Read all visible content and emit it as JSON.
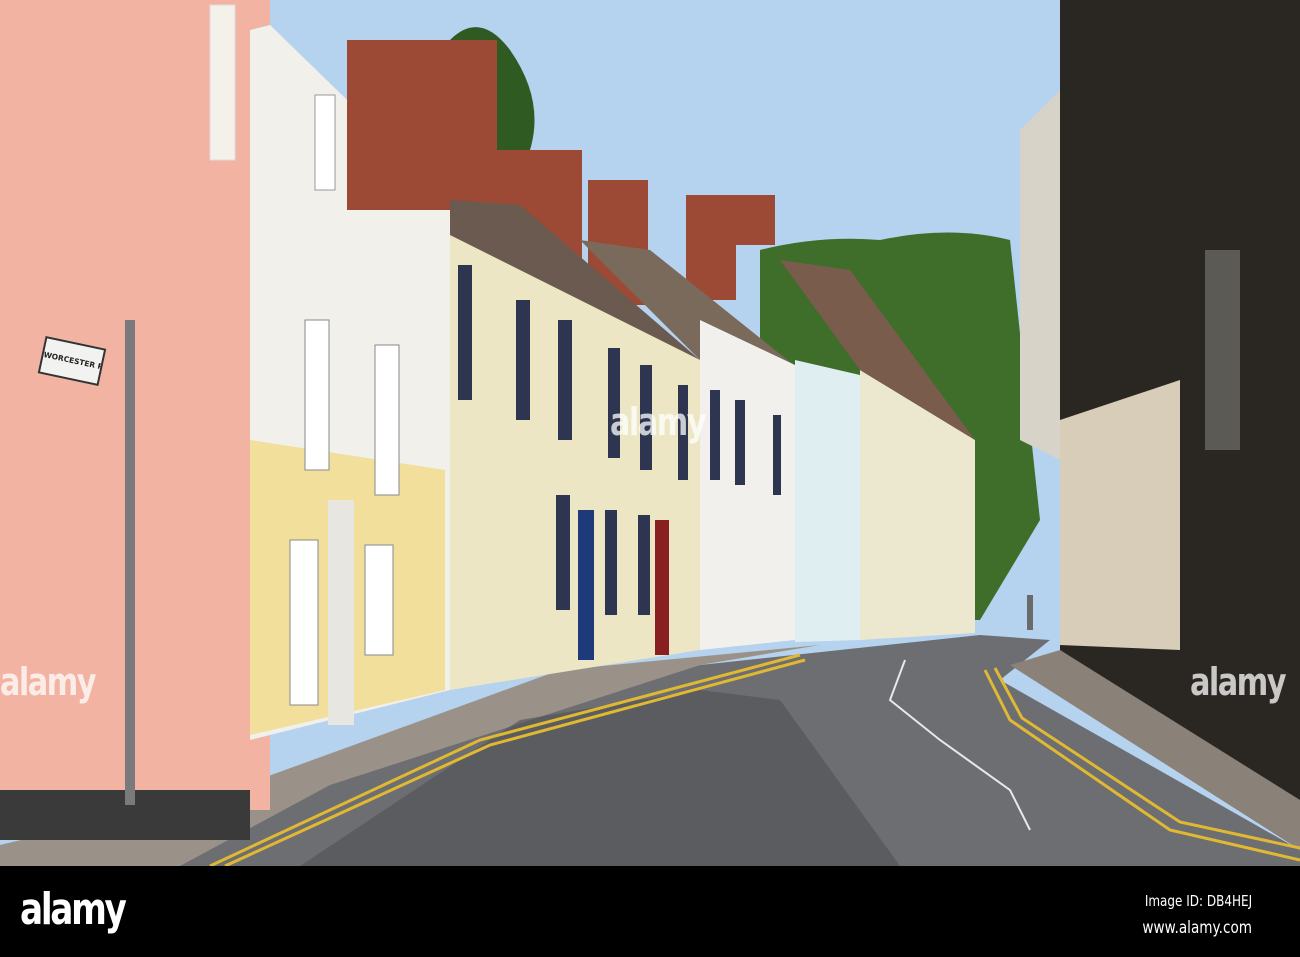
{
  "scene": {
    "description_colors": {
      "sky": "#b7d3ee",
      "pink_wall": "#f2b3a3",
      "yellow_wall": "#f1df9b",
      "cream_wall": "#ece6c4",
      "road": "#6d6e72",
      "hill": "#3f6e2a",
      "line_yellow": "#e0b832"
    },
    "street_sign": "WORCESTER ROAD",
    "watermark": "alamy"
  },
  "footer": {
    "logo": "alamy",
    "image_id": "Image ID: DB4HEJ",
    "url": "www.alamy.com"
  }
}
